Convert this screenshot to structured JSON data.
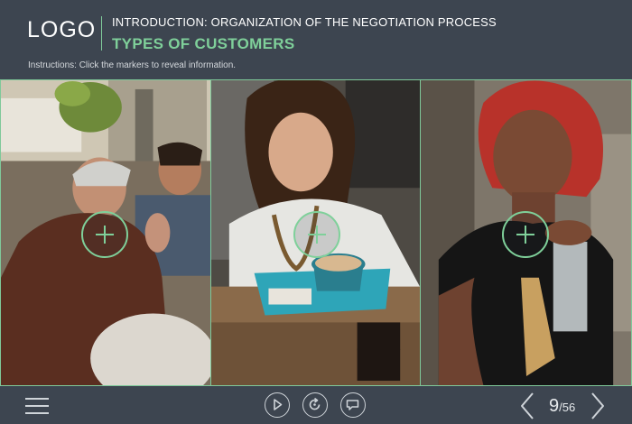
{
  "header": {
    "logo": "LOGO",
    "module_title": "INTRODUCTION: ORGANIZATION OF THE NEGOTIATION PROCESS",
    "slide_title": "TYPES OF CUSTOMERS",
    "instructions": "Instructions: Click the markers to reveal information."
  },
  "panels": [
    {
      "photo": "older-man-talking-with-younger-man",
      "marker_icon": "plus-icon"
    },
    {
      "photo": "smiling-woman-at-cafe-table-with-coffee",
      "marker_icon": "plus-icon"
    },
    {
      "photo": "woman-with-red-hair-holding-drink",
      "marker_icon": "plus-icon"
    }
  ],
  "footer": {
    "menu_icon": "hamburger-menu-icon",
    "play_icon": "play-icon",
    "replay_icon": "replay-icon",
    "comment_icon": "comment-icon",
    "page_current": "9",
    "page_total": "/56"
  },
  "colors": {
    "background": "#3d4550",
    "accent": "#7fd09a",
    "text": "#ffffff"
  }
}
